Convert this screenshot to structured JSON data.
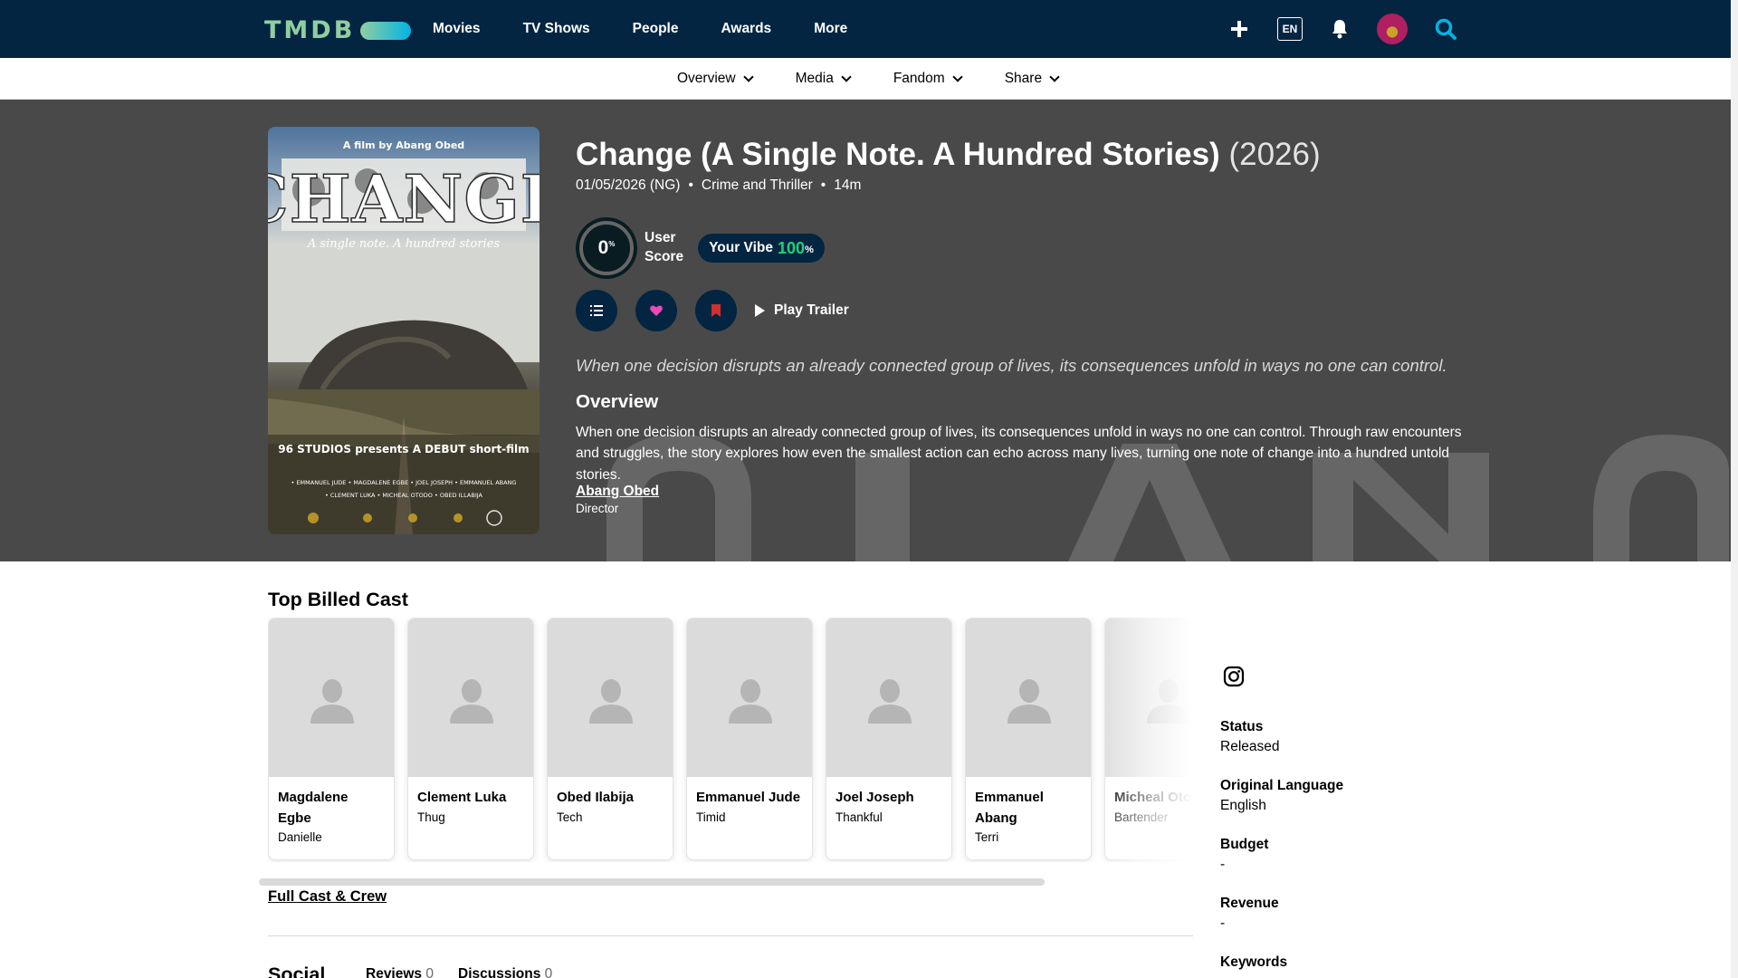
{
  "nav": {
    "logo": "TMDB",
    "links": [
      "Movies",
      "TV Shows",
      "People",
      "Awards",
      "More"
    ],
    "lang": "EN"
  },
  "subnav": [
    "Overview",
    "Media",
    "Fandom",
    "Share"
  ],
  "movie": {
    "title": "Change (A Single Note. A Hundred Stories)",
    "year": "(2026)",
    "release": "01/05/2026 (NG)",
    "genres": "Crime and Thriller",
    "runtime": "14m",
    "score": "0",
    "score_label_1": "User",
    "score_label_2": "Score",
    "vibe_label": "Your Vibe",
    "vibe_value": "100",
    "vibe_pct": "%",
    "play_trailer": "Play Trailer",
    "tagline": "When one decision disrupts an already connected group of lives, its consequences unfold in ways no one can control.",
    "overview_heading": "Overview",
    "overview": "When one decision disrupts an already connected group of lives, its consequences unfold in ways no one can control. Through raw encounters and struggles, the story explores how even the smallest action can echo across many lives, turning one note of change into a hundred untold stories.",
    "director_name": "Abang Obed",
    "director_role": "Director"
  },
  "poster": {
    "top_line": "A film by Abang Obed",
    "word": "CHANGE",
    "sub": "A single note.   A hundred stories",
    "presents": "96 STUDIOS presents A DEBUT short-film",
    "starring_1": "• EMMANUEL JUDE  • MAGDALENE EGBE  • JOEL JOSEPH  • EMMANUEL ABANG",
    "starring_2": "• CLEMENT LUKA  • MICHEAL OTODO  • OBED ILLABIJA"
  },
  "cast": {
    "heading": "Top Billed Cast",
    "members": [
      {
        "name": "Magdalene Egbe",
        "character": "Danielle"
      },
      {
        "name": "Clement Luka",
        "character": "Thug"
      },
      {
        "name": "Obed Ilabija",
        "character": "Tech"
      },
      {
        "name": "Emmanuel Jude",
        "character": "Timid"
      },
      {
        "name": "Joel Joseph",
        "character": "Thankful"
      },
      {
        "name": "Emmanuel Abang",
        "character": "Terri"
      },
      {
        "name": "Micheal Otodo",
        "character": "Bartender"
      }
    ],
    "full_cast_link": "Full Cast & Crew"
  },
  "social": {
    "heading": "Social",
    "reviews_label": "Reviews",
    "reviews_count": "0",
    "discussions_label": "Discussions",
    "discussions_count": "0"
  },
  "facts": {
    "status_label": "Status",
    "status": "Released",
    "language_label": "Original Language",
    "language": "English",
    "budget_label": "Budget",
    "budget": "-",
    "revenue_label": "Revenue",
    "revenue": "-",
    "keywords_label": "Keywords"
  },
  "colors": {
    "nav_bg": "#032541",
    "accent_green": "#90cea1",
    "accent_blue": "#01b4e4",
    "hero_bg": "#494949",
    "vibe_green": "#21d07a",
    "heart": "#ef47b6",
    "bookmark": "#cf3131"
  }
}
